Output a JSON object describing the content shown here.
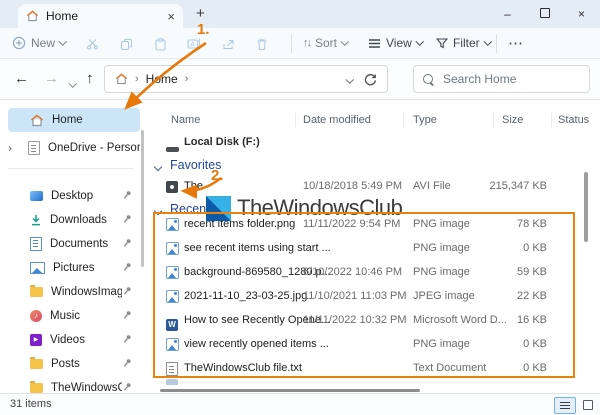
{
  "titlebar": {
    "tab_title": "Home"
  },
  "toolbar": {
    "new": "New",
    "sort": "Sort",
    "view": "View",
    "filter": "Filter",
    "more": "⋯"
  },
  "addressbar": {
    "breadcrumb": [
      "Home"
    ],
    "search_placeholder": "Search Home"
  },
  "sidebar": {
    "top_items": [
      {
        "label": "Home",
        "icon": "home",
        "selected": true
      },
      {
        "label": "OneDrive - Personal",
        "icon": "page",
        "expandable": true
      }
    ],
    "pinned_items": [
      {
        "label": "Desktop",
        "icon": "desktop"
      },
      {
        "label": "Downloads",
        "icon": "downloads"
      },
      {
        "label": "Documents",
        "icon": "docs"
      },
      {
        "label": "Pictures",
        "icon": "pics"
      },
      {
        "label": "WindowsImageBacku",
        "icon": "folder"
      },
      {
        "label": "Music",
        "icon": "music"
      },
      {
        "label": "Videos",
        "icon": "videos"
      },
      {
        "label": "Posts",
        "icon": "folder"
      },
      {
        "label": "TheWindowsClub",
        "icon": "folder"
      }
    ]
  },
  "list": {
    "columns": [
      "Name",
      "Date modified",
      "Type",
      "Size",
      "Status"
    ],
    "drive_row": {
      "name": "Local Disk (F:)"
    },
    "groups": [
      {
        "label": "Favorites",
        "rows": [
          {
            "name": "The",
            "date": "10/18/2018 5:49 PM",
            "type": "AVI File",
            "size": "215,347 KB",
            "icon": "media"
          }
        ]
      },
      {
        "label": "Recent",
        "rows": [
          {
            "name": "recent items folder.png",
            "date": "11/11/2022 9:54 PM",
            "type": "PNG image",
            "size": "78 KB",
            "icon": "img"
          },
          {
            "name": "see recent items using start ...",
            "date": "",
            "type": "PNG image",
            "size": "0 KB",
            "icon": "img"
          },
          {
            "name": "background-869580_1280.p...",
            "date": "6/10/2022 10:46 PM",
            "type": "PNG image",
            "size": "59 KB",
            "icon": "img"
          },
          {
            "name": "2021-11-10_23-03-25.jpg",
            "date": "11/10/2021 11:03 PM",
            "type": "JPEG image",
            "size": "22 KB",
            "icon": "img"
          },
          {
            "name": "How to see Recently Opene...",
            "date": "11/11/2022 10:32 PM",
            "type": "Microsoft Word D...",
            "size": "16 KB",
            "icon": "word"
          },
          {
            "name": "view recently opened items ...",
            "date": "",
            "type": "PNG image",
            "size": "0 KB",
            "icon": "img"
          },
          {
            "name": "TheWindowsClub file.txt",
            "date": "",
            "type": "Text Document",
            "size": "0 KB",
            "icon": "txt"
          }
        ]
      }
    ]
  },
  "statusbar": {
    "items_count": "31 items"
  },
  "annotations": {
    "step1": "1.",
    "step2": "2."
  },
  "watermark": {
    "text": "TheWindowsClub"
  },
  "colors": {
    "annotation_orange": "#e8820f",
    "selection_blue": "#cce6f7",
    "group_header_navy": "#24459c",
    "watermark_light_blue": "#36b1e6",
    "watermark_dark_blue": "#0d5ba8",
    "titlebar_bg": "#e4ecf6",
    "surface_bg": "#f8fbfe"
  }
}
